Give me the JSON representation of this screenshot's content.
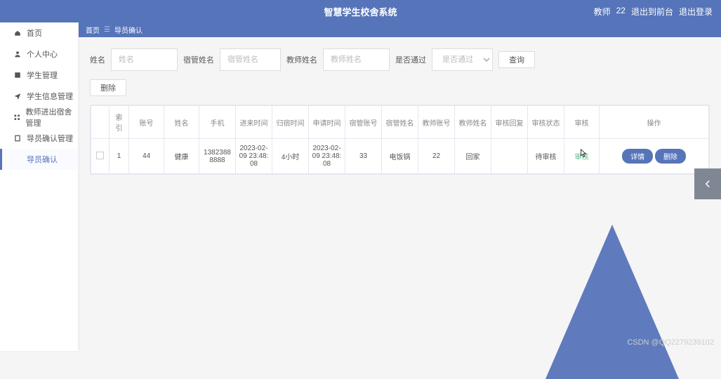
{
  "header": {
    "title": "智慧学生校舍系统",
    "user_role": "教师",
    "user_id": "22",
    "exit_front": "退出到前台",
    "exit_login": "退出登录"
  },
  "sidebar": {
    "items": [
      {
        "label": "首页",
        "icon": "home-icon"
      },
      {
        "label": "个人中心",
        "icon": "user-icon"
      },
      {
        "label": "学生管理",
        "icon": "book-icon"
      },
      {
        "label": "学生信息管理",
        "icon": "send-icon"
      },
      {
        "label": "教师进出宿舍管理",
        "icon": "grid-icon"
      },
      {
        "label": "导员确认管理",
        "icon": "clipboard-icon"
      },
      {
        "label": "导员确认",
        "icon": "blank-icon"
      }
    ]
  },
  "breadcrumb": {
    "home": "首页",
    "sep": "☰",
    "current": "导员确认"
  },
  "filters": {
    "name_label": "姓名",
    "name_ph": "姓名",
    "dorm_label": "宿管姓名",
    "dorm_ph": "宿管姓名",
    "teacher_label": "教师姓名",
    "teacher_ph": "教师姓名",
    "pass_label": "是否通过",
    "pass_ph": "是否通过",
    "query_btn": "查询",
    "delete_btn": "删除"
  },
  "table": {
    "headers": [
      "",
      "索引",
      "账号",
      "姓名",
      "手机",
      "进来时间",
      "归宿时间",
      "申请时间",
      "宿管账号",
      "宿管姓名",
      "教师账号",
      "教师姓名",
      "审核回复",
      "审核状态",
      "审核",
      "操作"
    ],
    "row": {
      "index": "1",
      "account": "44",
      "name": "健康",
      "phone": "13823888888",
      "in_time": "2023-02-09 23:48:08",
      "stay": "4小时",
      "apply_time": "2023-02-09 23:48:08",
      "dorm_acc": "33",
      "dorm_name": "电饭锅",
      "teacher_acc": "22",
      "teacher_name": "回家",
      "review_reply": "",
      "review_status": "待审核",
      "review_link": "审核",
      "detail_btn": "详情",
      "delete_btn": "删除"
    }
  },
  "watermark": "CSDN @QQ2279239102"
}
